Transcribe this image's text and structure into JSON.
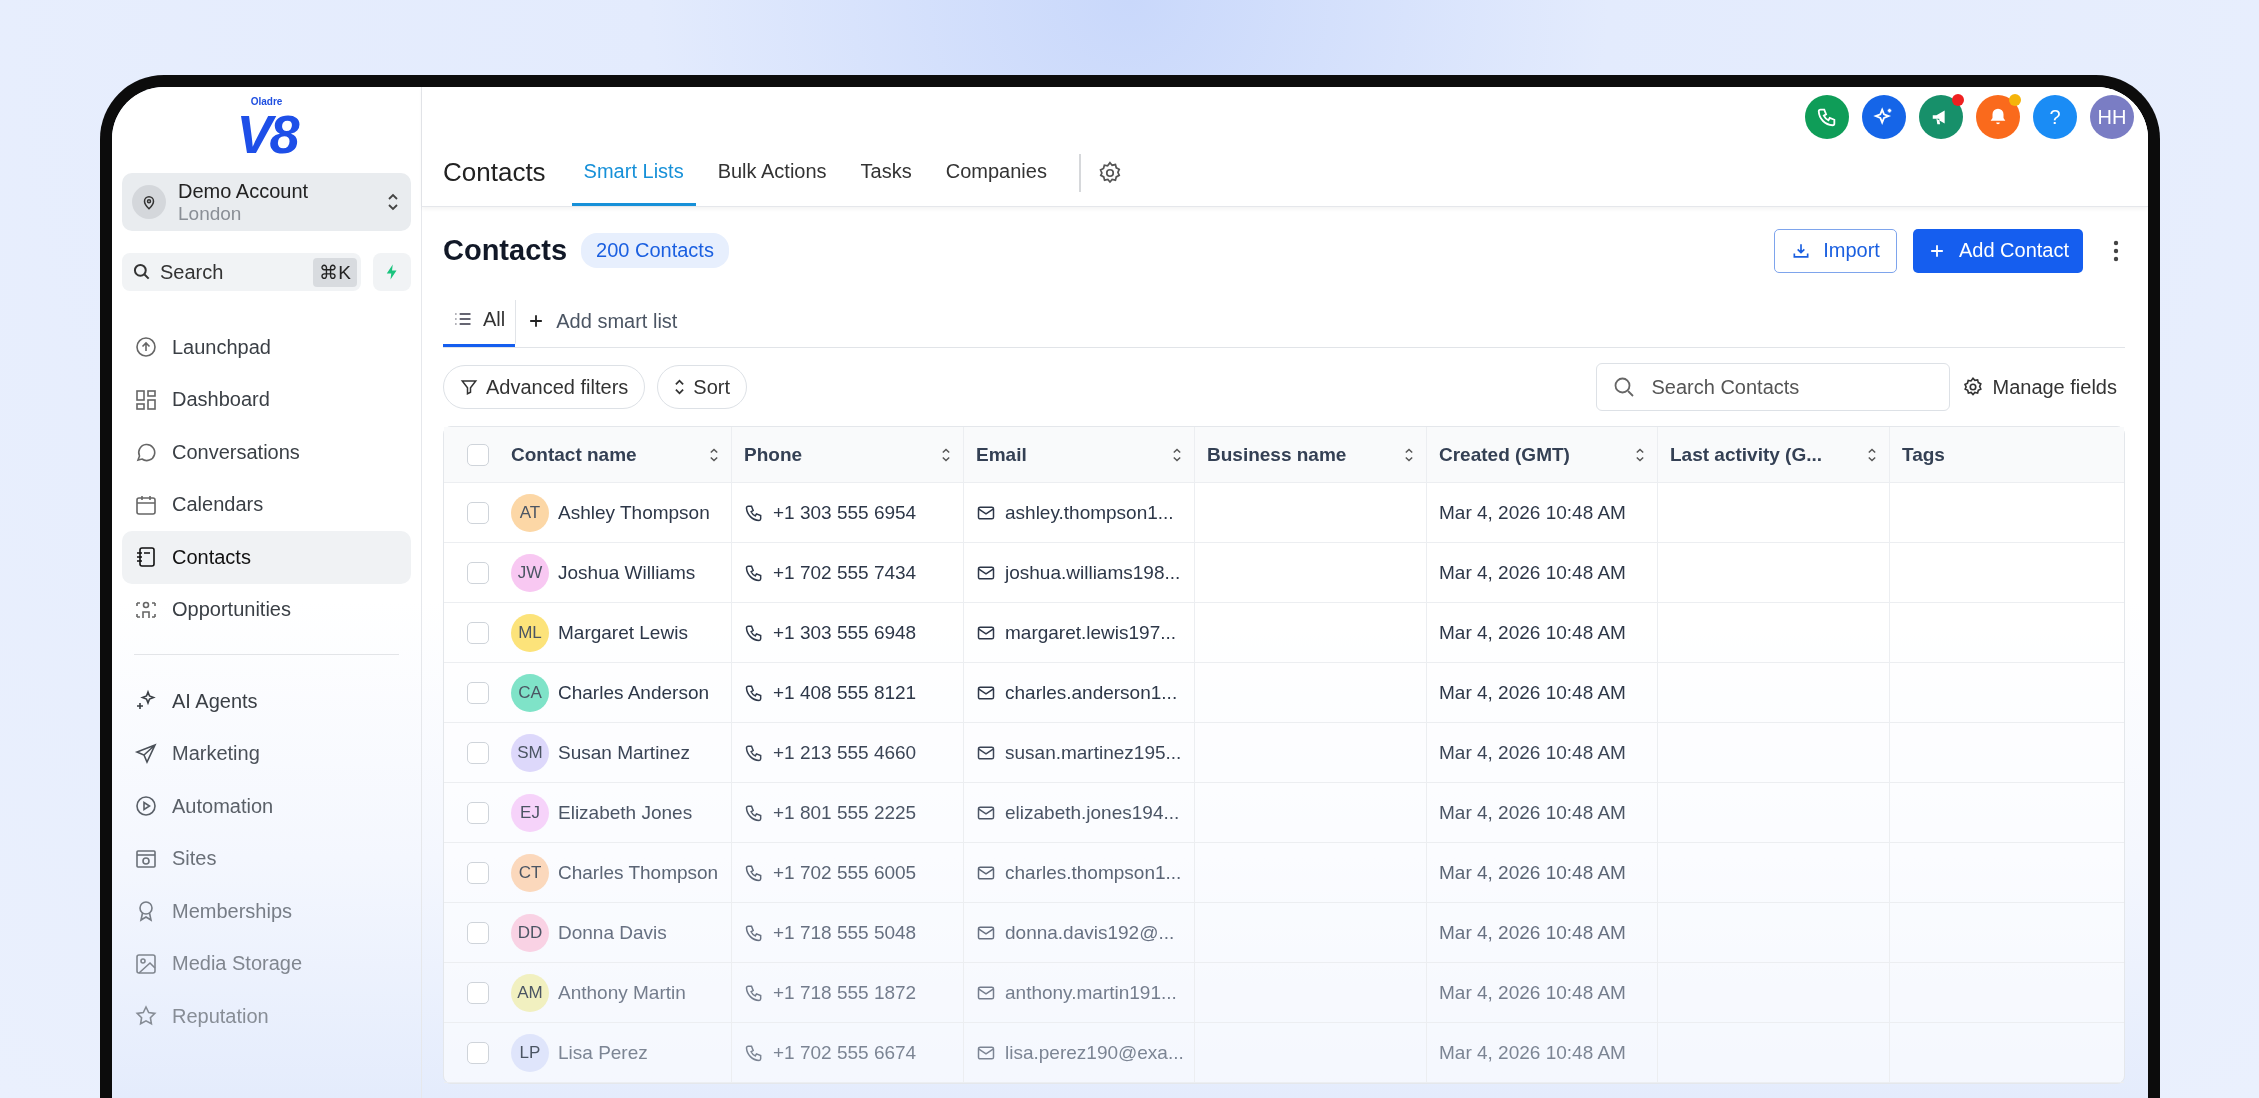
{
  "logo": {
    "brand": "Oladre",
    "mark": "V8"
  },
  "account": {
    "name": "Demo Account",
    "location": "London"
  },
  "sidebar_search": {
    "placeholder": "Search",
    "shortcut": "⌘K"
  },
  "sidebar": {
    "items": [
      {
        "label": "Launchpad",
        "selected": false
      },
      {
        "label": "Dashboard",
        "selected": false
      },
      {
        "label": "Conversations",
        "selected": false
      },
      {
        "label": "Calendars",
        "selected": false
      },
      {
        "label": "Contacts",
        "selected": true
      },
      {
        "label": "Opportunities",
        "selected": false
      }
    ],
    "more_items": [
      {
        "label": "AI Agents",
        "selected": false
      },
      {
        "label": "Marketing",
        "selected": false
      },
      {
        "label": "Automation",
        "selected": false
      },
      {
        "label": "Sites",
        "selected": false
      },
      {
        "label": "Memberships",
        "selected": false
      },
      {
        "label": "Media Storage",
        "selected": false
      },
      {
        "label": "Reputation",
        "selected": false
      }
    ]
  },
  "top_actions": [
    {
      "kind": "phone",
      "color": "#0f9d58"
    },
    {
      "kind": "sparkle",
      "color": "#1565e8"
    },
    {
      "kind": "megaphone",
      "color": "#17906a",
      "badge": {
        "color": "#ef2020"
      }
    },
    {
      "kind": "bell",
      "color": "#fa6a1c",
      "badge": {
        "color": "#f5b40a"
      }
    },
    {
      "kind": "help",
      "color": "#1a8cf5",
      "text": "?"
    },
    {
      "kind": "avatar",
      "color": "#7a7dc4",
      "text": "HH"
    }
  ],
  "header": {
    "title": "Contacts",
    "tabs": [
      {
        "label": "Smart Lists",
        "selected": true
      },
      {
        "label": "Bulk Actions",
        "selected": false
      },
      {
        "label": "Tasks",
        "selected": false
      },
      {
        "label": "Companies",
        "selected": false
      }
    ]
  },
  "page": {
    "title": "Contacts",
    "count": "200 Contacts",
    "import": "Import",
    "add": "Add Contact"
  },
  "list_tabs": [
    {
      "kind": "list",
      "label": "All",
      "selected": true
    },
    {
      "kind": "add",
      "label": "Add smart list",
      "selected": false
    }
  ],
  "filters": {
    "buttons": [
      {
        "kind": "filter",
        "label": "Advanced filters"
      },
      {
        "kind": "sort",
        "label": "Sort"
      }
    ],
    "search_placeholder": "Search Contacts",
    "manage": "Manage fields"
  },
  "table": {
    "all_checked": false,
    "columns": [
      {
        "label": "Contact name",
        "sortable": true
      },
      {
        "label": "Phone",
        "sortable": true
      },
      {
        "label": "Email",
        "sortable": true
      },
      {
        "label": "Business name",
        "sortable": true
      },
      {
        "label": "Created (GMT)",
        "sortable": true
      },
      {
        "label": "Last activity (G...",
        "sortable": true
      },
      {
        "label": "Tags",
        "sortable": false
      }
    ],
    "rows": [
      {
        "checked": false,
        "initials": "AT",
        "color": "#fcd7a6",
        "name": "Ashley Thompson",
        "phone": "+1 303 555 6954",
        "email": "ashley.thompson1...",
        "created": "Mar 4, 2026 10:48 AM"
      },
      {
        "checked": false,
        "initials": "JW",
        "color": "#f8c8f2",
        "name": "Joshua Williams",
        "phone": "+1 702 555 7434",
        "email": "joshua.williams198...",
        "created": "Mar 4, 2026 10:48 AM"
      },
      {
        "checked": false,
        "initials": "ML",
        "color": "#fce37a",
        "name": "Margaret Lewis",
        "phone": "+1 303 555 6948",
        "email": "margaret.lewis197...",
        "created": "Mar 4, 2026 10:48 AM"
      },
      {
        "checked": false,
        "initials": "CA",
        "color": "#7fe3c8",
        "name": "Charles Anderson",
        "phone": "+1 408 555 8121",
        "email": "charles.anderson1...",
        "created": "Mar 4, 2026 10:48 AM"
      },
      {
        "checked": false,
        "initials": "SM",
        "color": "#ddd8fb",
        "name": "Susan Martinez",
        "phone": "+1 213 555 4660",
        "email": "susan.martinez195...",
        "created": "Mar 4, 2026 10:48 AM"
      },
      {
        "checked": false,
        "initials": "EJ",
        "color": "#f6d3fa",
        "name": "Elizabeth Jones",
        "phone": "+1 801 555 2225",
        "email": "elizabeth.jones194...",
        "created": "Mar 4, 2026 10:48 AM"
      },
      {
        "checked": false,
        "initials": "CT",
        "color": "#fbd8bc",
        "name": "Charles Thompson",
        "phone": "+1 702 555 6005",
        "email": "charles.thompson1...",
        "created": "Mar 4, 2026 10:48 AM"
      },
      {
        "checked": false,
        "initials": "DD",
        "color": "#f9d2e4",
        "name": "Donna Davis",
        "phone": "+1 718 555 5048",
        "email": "donna.davis192@...",
        "created": "Mar 4, 2026 10:48 AM"
      },
      {
        "checked": false,
        "initials": "AM",
        "color": "#f1f0c0",
        "name": "Anthony Martin",
        "phone": "+1 718 555 1872",
        "email": "anthony.martin191...",
        "created": "Mar 4, 2026 10:48 AM"
      },
      {
        "checked": false,
        "initials": "LP",
        "color": "#dfe5fb",
        "name": "Lisa Perez",
        "phone": "+1 702 555 6674",
        "email": "lisa.perez190@exa...",
        "created": "Mar 4, 2026 10:48 AM"
      }
    ]
  }
}
